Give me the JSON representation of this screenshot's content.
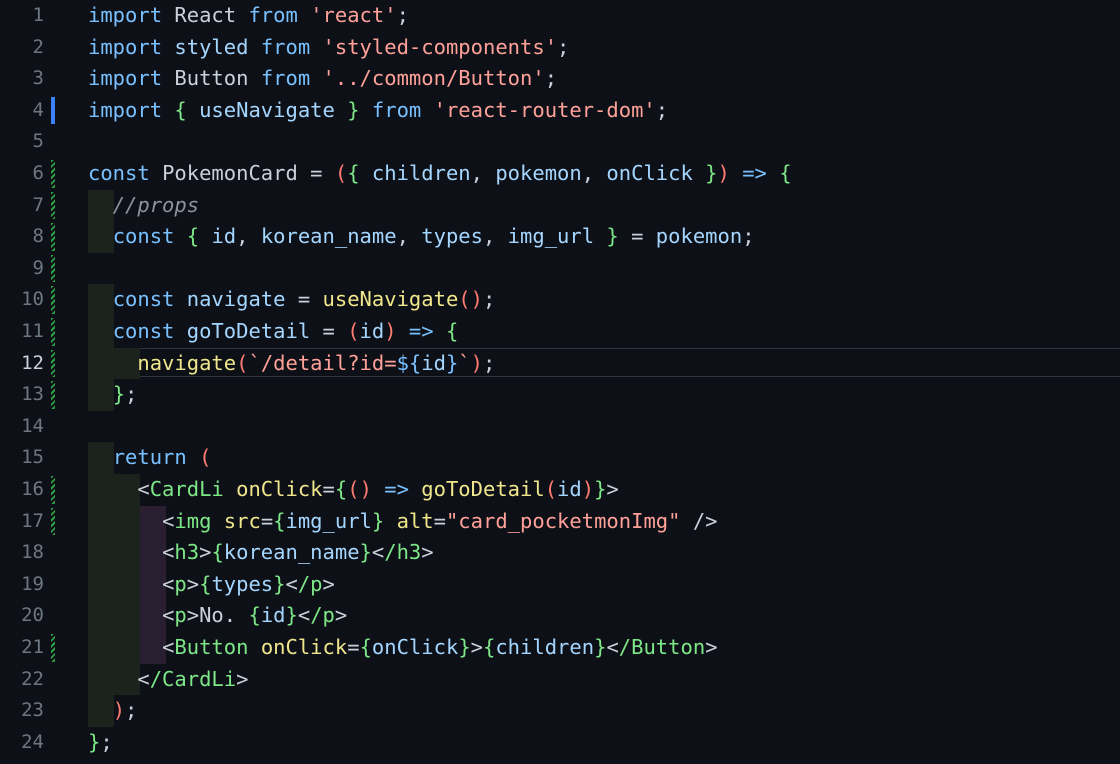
{
  "editor": {
    "language": "javascript",
    "active_line": 12,
    "colors": {
      "background": "#0d1117",
      "keyword": "#79c0ff",
      "string": "#ffa198",
      "tag": "#7ee787",
      "function": "#f0e68c",
      "comment": "#8b949e",
      "line_number": "#6e7681",
      "modified_marker": "#3b82f6",
      "added_marker": "#2ea043"
    },
    "lines": [
      {
        "num": "1",
        "text": "import React from 'react';",
        "marker": ""
      },
      {
        "num": "2",
        "text": "import styled from 'styled-components';",
        "marker": ""
      },
      {
        "num": "3",
        "text": "import Button from '../common/Button';",
        "marker": ""
      },
      {
        "num": "4",
        "text": "import { useNavigate } from 'react-router-dom';",
        "marker": "modified"
      },
      {
        "num": "5",
        "text": "",
        "marker": ""
      },
      {
        "num": "6",
        "text": "const PokemonCard = ({ children, pokemon, onClick }) => {",
        "marker": "added"
      },
      {
        "num": "7",
        "text": "  //props",
        "marker": "added"
      },
      {
        "num": "8",
        "text": "  const { id, korean_name, types, img_url } = pokemon;",
        "marker": "added"
      },
      {
        "num": "9",
        "text": "",
        "marker": "added"
      },
      {
        "num": "10",
        "text": "  const navigate = useNavigate();",
        "marker": "added"
      },
      {
        "num": "11",
        "text": "  const goToDetail = (id) => {",
        "marker": "added"
      },
      {
        "num": "12",
        "text": "    navigate(`/detail?id=${id}`);",
        "marker": "added"
      },
      {
        "num": "13",
        "text": "  };",
        "marker": "added"
      },
      {
        "num": "14",
        "text": "",
        "marker": ""
      },
      {
        "num": "15",
        "text": "  return (",
        "marker": ""
      },
      {
        "num": "16",
        "text": "    <CardLi onClick={() => goToDetail(id)}>",
        "marker": "added"
      },
      {
        "num": "17",
        "text": "      <img src={img_url} alt=\"card_pocketmonImg\" />",
        "marker": "added"
      },
      {
        "num": "18",
        "text": "      <h3>{korean_name}</h3>",
        "marker": ""
      },
      {
        "num": "19",
        "text": "      <p>{types}</p>",
        "marker": ""
      },
      {
        "num": "20",
        "text": "      <p>No. {id}</p>",
        "marker": ""
      },
      {
        "num": "21",
        "text": "      <Button onClick={onClick}>{children}</Button>",
        "marker": "added"
      },
      {
        "num": "22",
        "text": "    </CardLi>",
        "marker": ""
      },
      {
        "num": "23",
        "text": "  );",
        "marker": ""
      },
      {
        "num": "24",
        "text": "};",
        "marker": ""
      }
    ]
  }
}
